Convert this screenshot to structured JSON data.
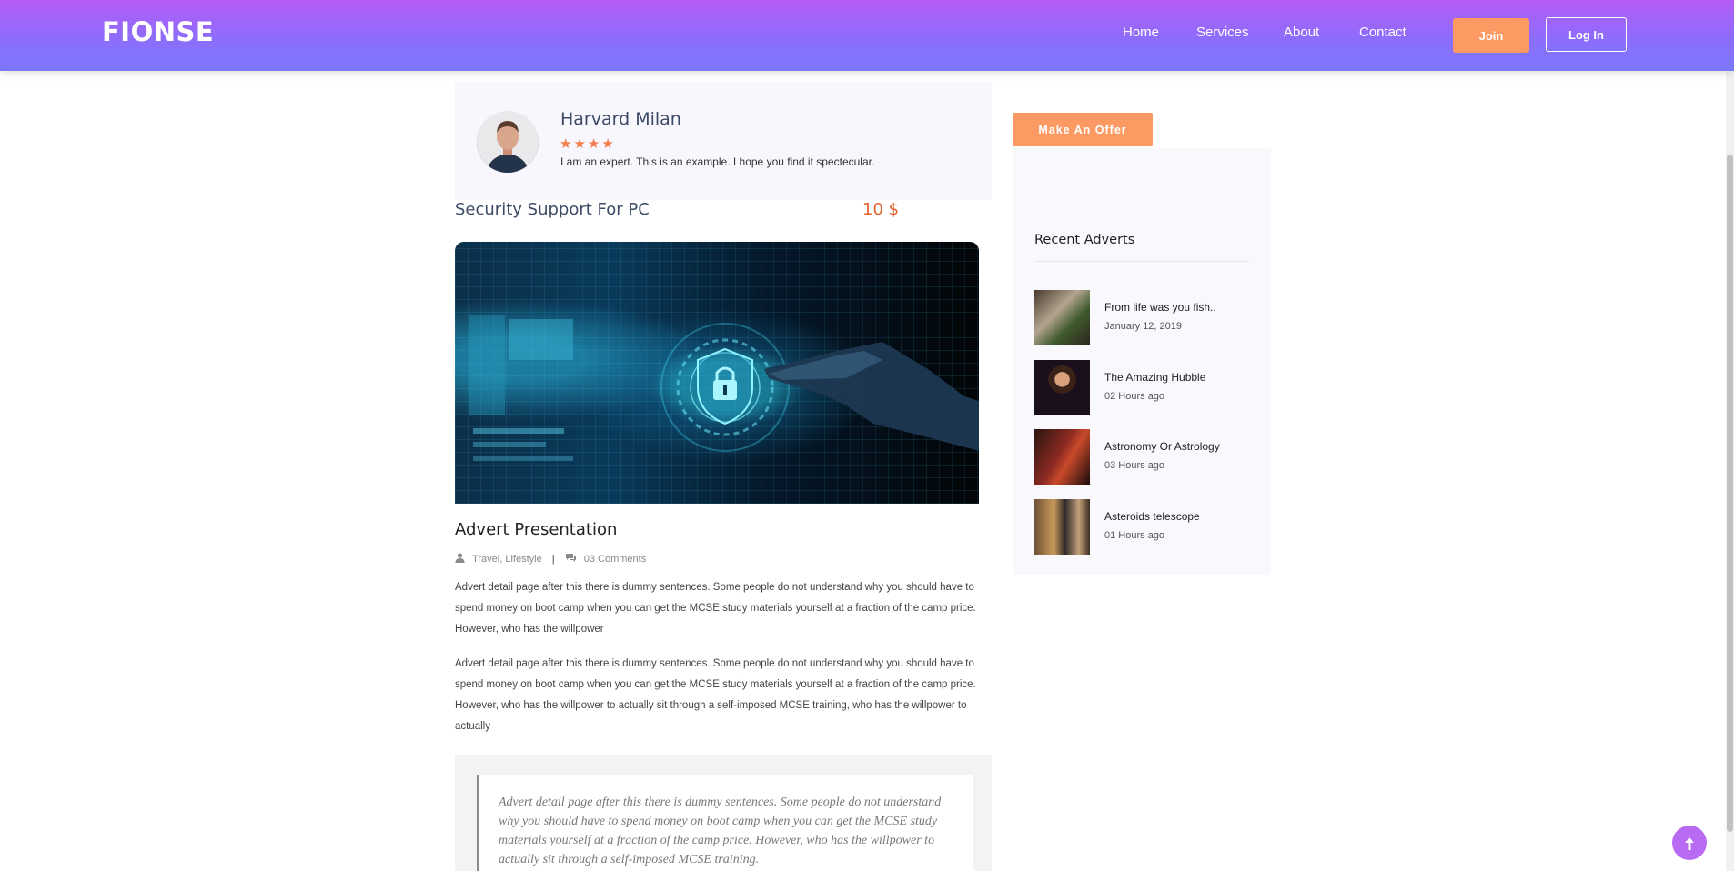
{
  "brand": {
    "logo": "FIONSE"
  },
  "nav": {
    "items": [
      "Home",
      "Services",
      "About",
      "Contact"
    ],
    "join_label": "Join",
    "login_label": "Log In"
  },
  "author": {
    "name": "Harvard Milan",
    "rating_stars": 4,
    "stars_text": "★★★★",
    "bio": "I am an expert. This is an example. I hope you find it spectecular."
  },
  "advert": {
    "title": "Security Support For PC",
    "price": "10 $",
    "section_title": "Advert Presentation",
    "categories": "Travel, Lifestyle",
    "separator": "|",
    "comments": "03 Comments",
    "paragraph_1": "Advert detail page after this there is dummy sentences. Some people do not understand why you should have to spend money on boot camp when you can get the MCSE study materials yourself at a fraction of the camp price. However, who has the willpower",
    "paragraph_2": "Advert detail page after this there is dummy sentences. Some people do not understand why you should have to spend money on boot camp when you can get the MCSE study materials yourself at a fraction of the camp price. However, who has the willpower to actually sit through a self-imposed MCSE training, who has the willpower to actually",
    "quote": "Advert detail page after this there is dummy sentences. Some people do not understand why you should have to spend money on boot camp when you can get the MCSE study materials yourself at a fraction of the camp price. However, who has the willpower to actually sit through a self-imposed MCSE training."
  },
  "sidebar": {
    "offer_label": "Make An Offer",
    "recent_heading": "Recent Adverts",
    "recent": [
      {
        "title": "From life was you fish..",
        "time": "January 12, 2019"
      },
      {
        "title": "The Amazing Hubble",
        "time": "02 Hours ago"
      },
      {
        "title": "Astronomy Or Astrology",
        "time": "03 Hours ago"
      },
      {
        "title": "Asteroids telescope",
        "time": "01 Hours ago"
      }
    ]
  },
  "colors": {
    "accent": "#fd9a64",
    "price": "#e4622f",
    "header_gradient_top": "#b45cf6",
    "header_gradient_bottom": "#7a78fd"
  },
  "icons": [
    "user-icon",
    "comments-icon",
    "arrow-up-icon"
  ]
}
